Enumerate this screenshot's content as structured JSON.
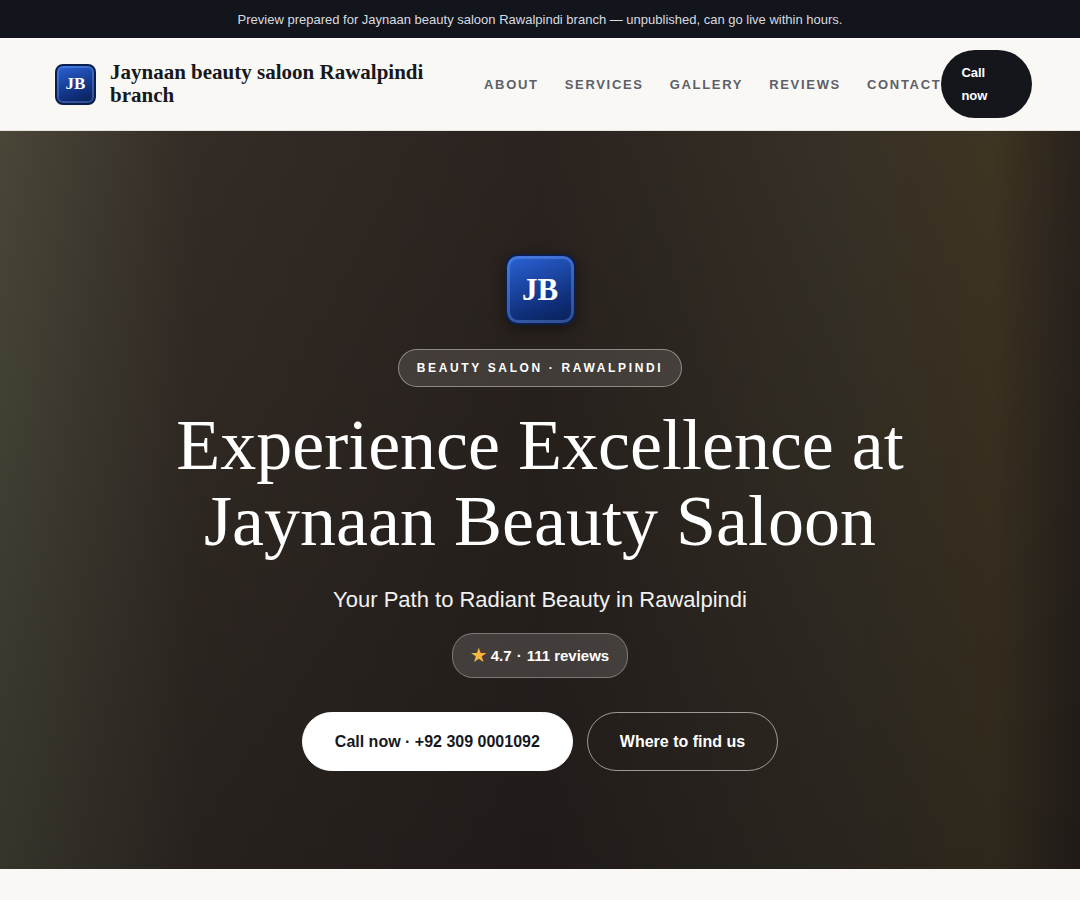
{
  "banner": {
    "text": "Preview prepared for Jaynaan beauty saloon Rawalpindi branch — unpublished, can go live within hours."
  },
  "header": {
    "logo": "JB",
    "brand": "Jaynaan beauty saloon Rawalpindi branch",
    "nav": [
      "ABOUT",
      "SERVICES",
      "GALLERY",
      "REVIEWS",
      "CONTACT"
    ],
    "call_button": "Call now"
  },
  "hero": {
    "logo": "JB",
    "badge": "BEAUTY SALON · RAWALPINDI",
    "title": "Experience Excellence at Jaynaan Beauty Saloon",
    "subtitle": "Your Path to Radiant Beauty in Rawalpindi",
    "rating": {
      "star": "★",
      "score": "4.7",
      "separator": "·",
      "reviews": "111 reviews"
    },
    "buttons": [
      {
        "label": "Call now · +92 309 0001092",
        "kind": "primary"
      },
      {
        "label": "Where to find us",
        "kind": "outline"
      }
    ]
  }
}
